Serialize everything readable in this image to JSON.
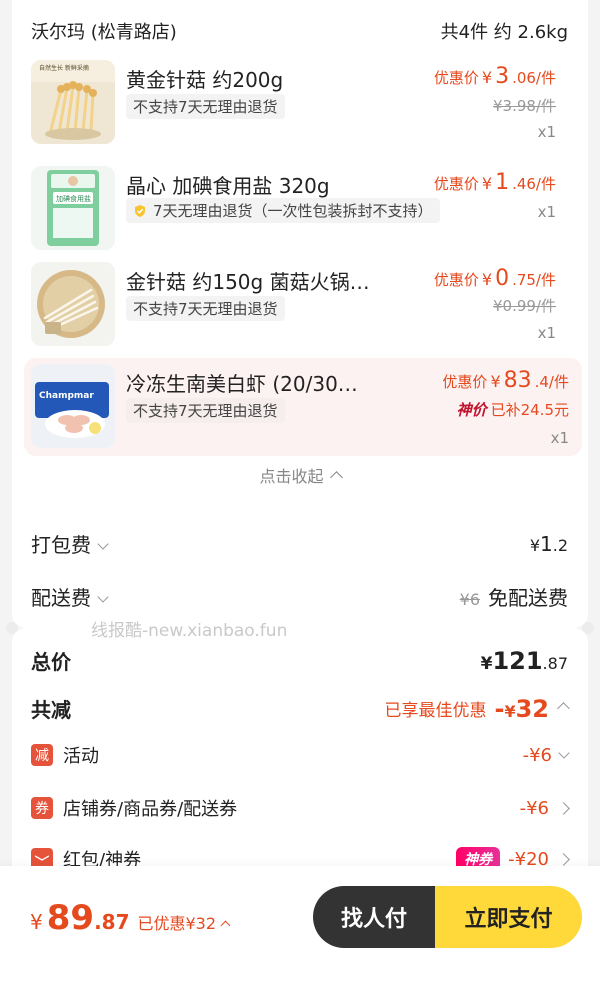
{
  "store": {
    "name": "沃尔玛 (松青路店)",
    "summary": "共4件 约 2.6kg"
  },
  "items": [
    {
      "title": "黄金针菇 约200g",
      "tag": "不支持7天无理由退货",
      "price_label": "优惠价",
      "yen": "¥",
      "price_int": "3",
      "price_dec": ".06/件",
      "orig_price": "¥3.98/件",
      "qty": "x1",
      "image_text": "自然生长 新鲜采摘",
      "image_subtext": "新鲜采摘"
    },
    {
      "title": "晶心 加碘食用盐 320g",
      "tag": "7天无理由退货（一次性包装拆封不支持）",
      "price_label": "优惠价",
      "yen": "¥",
      "price_int": "1",
      "price_dec": ".46/件",
      "qty": "x1",
      "image_text": "加碘食用盐"
    },
    {
      "title": "金针菇 约150g 菌菇火锅…",
      "tag": "不支持7天无理由退货",
      "price_label": "优惠价",
      "yen": "¥",
      "price_int": "0",
      "price_dec": ".75/件",
      "orig_price": "¥0.99/件",
      "qty": "x1"
    },
    {
      "title": "冷冻生南美白虾 (20/30…",
      "tag": "不支持7天无理由退货",
      "price_label": "优惠价",
      "yen": "¥",
      "price_int": "83",
      "price_dec": ".4/件",
      "badge": "神价",
      "subsidy": "已补24.5元",
      "qty": "x1",
      "image_text": "Champmar"
    }
  ],
  "collapse_label": "点击收起",
  "fees": {
    "packing_label": "打包费",
    "packing_yen": "¥",
    "packing_int": "1",
    "packing_dec": ".2",
    "delivery_label": "配送费",
    "delivery_orig": "¥6",
    "delivery_val": "免配送费"
  },
  "watermark": "线报酷-new.xianbao.fun",
  "total": {
    "label": "总价",
    "yen": "¥",
    "int": "121",
    "dec": ".87"
  },
  "discount": {
    "label": "共减",
    "best": "已享最佳优惠",
    "prefix": "-",
    "yen": "¥",
    "amount": "32",
    "rows": [
      {
        "icon": "减",
        "label": "活动",
        "value": "-¥6"
      },
      {
        "icon": "券",
        "label": "店铺券/商品券/配送券",
        "value": "-¥6"
      },
      {
        "label": "红包/神券",
        "badge": "神券",
        "value": "-¥20"
      }
    ]
  },
  "bottom": {
    "yen": "¥",
    "int": "89",
    "dec": ".87",
    "saved": "已优惠¥32",
    "friend_pay": "找人付",
    "pay_now": "立即支付"
  },
  "colors": {
    "accent_red": "#e54a1f",
    "pay_yellow": "#ffd83a",
    "dark_button": "#333333"
  }
}
